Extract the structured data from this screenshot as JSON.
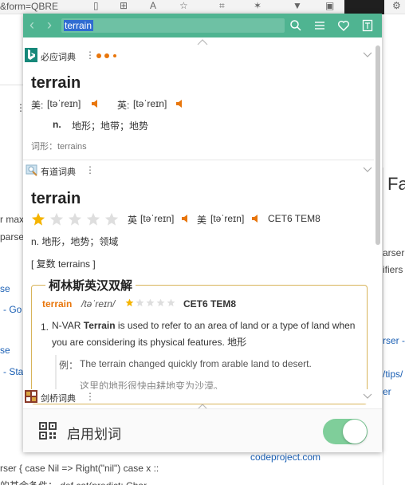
{
  "background": {
    "url_fragment": "&form=QBRE",
    "heading_partial": "Fa",
    "lines": {
      "r_max": "r max",
      "parse": "parse",
      "se_1": "se",
      "go": "- Go",
      "se_2": "se",
      "sta": "- Sta",
      "arser_right": "arser",
      "ifiers": "ifiers",
      "rser_right": "rser -",
      "tips": "/tips/",
      "er": "er",
      "codeproject": "codeproject.com",
      "bottom_code": "rser { case Nil => Right(\"nil\") case x ::",
      "bottom_code2": "的其余条件：  def cat(predict: Char"
    }
  },
  "popup": {
    "search": {
      "value": "terrain",
      "placeholder": ""
    },
    "bing": {
      "name": "必应词典",
      "word": "terrain",
      "us_label": "美:",
      "us_phonetic": "[təˈreɪn]",
      "uk_label": "英:",
      "uk_phonetic": "[təˈreɪn]",
      "pos": "n.",
      "meaning": "地形；地带；地势",
      "forms": "词形：terrains"
    },
    "youdao": {
      "name": "有道词典",
      "word": "terrain",
      "rating_stars": 1,
      "rating_max": 5,
      "uk_label": "英",
      "uk_phonetic": "[təˈreɪn]",
      "us_label": "美",
      "us_phonetic": "[təˈreɪn]",
      "tags": "CET6 TEM8",
      "meaning": "n. 地形，地势；领域",
      "plural": "[ 复数 terrains ]"
    },
    "collins": {
      "title": "柯林斯英汉双解",
      "word": "terrain",
      "phonetic": "/təˈreɪn/",
      "rating_stars": 1,
      "rating_max": 5,
      "tags": "CET6 TEM8",
      "def_num": "1.",
      "def_type": "N-VAR",
      "def_word": "Terrain",
      "def_rest_1": " is used to refer to an area of land or a type of land",
      "def_rest_2": "when you are considering its physical features.",
      "def_cn": "地形",
      "example_label": "例：",
      "example_en": "The terrain changed quickly from arable land to desert.",
      "example_cn": "这里的地形很快由耕地变为沙漠。"
    },
    "cambridge": {
      "name": "剑桥词典"
    },
    "footer": {
      "label": "启用划词",
      "toggle_on": true
    },
    "colors": {
      "topbar": "#4fb491",
      "accent_orange": "#e8760c",
      "star": "#f5b400",
      "toggle": "#7fce9a"
    }
  }
}
